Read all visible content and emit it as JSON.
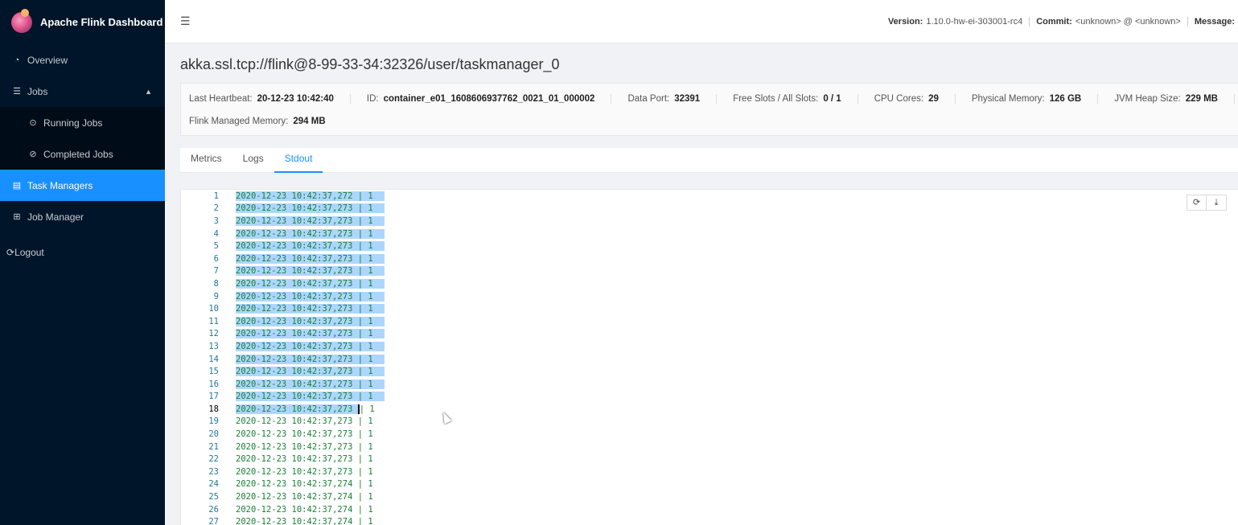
{
  "brand": {
    "title": "Apache Flink Dashboard"
  },
  "sidebar": {
    "items": [
      {
        "label": "Overview",
        "icon": "dashboard-icon"
      },
      {
        "label": "Jobs",
        "icon": "list-icon"
      },
      {
        "label": "Running Jobs",
        "icon": "play-circle-icon"
      },
      {
        "label": "Completed Jobs",
        "icon": "check-circle-icon"
      },
      {
        "label": "Task Managers",
        "icon": "schedule-icon"
      },
      {
        "label": "Job Manager",
        "icon": "build-icon"
      }
    ],
    "logout": "Logout"
  },
  "header": {
    "version_label": "Version:",
    "version": "1.10.0-hw-ei-303001-rc4",
    "commit_label": "Commit:",
    "commit": "<unknown> @ <unknown>",
    "message_label": "Message:"
  },
  "page": {
    "title": "akka.ssl.tcp://flink@8-99-33-34:32326/user/taskmanager_0"
  },
  "stats": {
    "row1": [
      {
        "label": "Last Heartbeat:",
        "value": "20-12-23 10:42:40"
      },
      {
        "label": "ID:",
        "value": "container_e01_1608606937762_0021_01_000002"
      },
      {
        "label": "Data Port:",
        "value": "32391"
      },
      {
        "label": "Free Slots / All Slots:",
        "value": "0 / 1"
      },
      {
        "label": "CPU Cores:",
        "value": "29"
      },
      {
        "label": "Physical Memory:",
        "value": "126 GB"
      },
      {
        "label": "JVM Heap Size:",
        "value": "229 MB"
      }
    ],
    "row2": [
      {
        "label": "Flink Managed Memory:",
        "value": "294 MB"
      }
    ]
  },
  "tabs": [
    "Metrics",
    "Logs",
    "Stdout"
  ],
  "active_tab": "Stdout",
  "stdout": {
    "lines": [
      "2020-12-23 10:42:37,272 | 1",
      "2020-12-23 10:42:37,273 | 1",
      "2020-12-23 10:42:37,273 | 1",
      "2020-12-23 10:42:37,273 | 1",
      "2020-12-23 10:42:37,273 | 1",
      "2020-12-23 10:42:37,273 | 1",
      "2020-12-23 10:42:37,273 | 1",
      "2020-12-23 10:42:37,273 | 1",
      "2020-12-23 10:42:37,273 | 1",
      "2020-12-23 10:42:37,273 | 1",
      "2020-12-23 10:42:37,273 | 1",
      "2020-12-23 10:42:37,273 | 1",
      "2020-12-23 10:42:37,273 | 1",
      "2020-12-23 10:42:37,273 | 1",
      "2020-12-23 10:42:37,273 | 1",
      "2020-12-23 10:42:37,273 | 1",
      "2020-12-23 10:42:37,273 | 1",
      "2020-12-23 10:42:37,273 | 1",
      "2020-12-23 10:42:37,273 | 1",
      "2020-12-23 10:42:37,273 | 1",
      "2020-12-23 10:42:37,273 | 1",
      "2020-12-23 10:42:37,273 | 1",
      "2020-12-23 10:42:37,273 | 1",
      "2020-12-23 10:42:37,274 | 1",
      "2020-12-23 10:42:37,274 | 1",
      "2020-12-23 10:42:37,274 | 1",
      "2020-12-23 10:42:37,274 | 1"
    ]
  },
  "toolbar": {
    "refresh_icon": "reload-icon",
    "download_icon": "download-icon"
  },
  "colors": {
    "sidebar_bg": "#001529",
    "accent": "#1890ff",
    "selection": "#add6ff",
    "log_text": "#1a7f37",
    "line_number": "#237893"
  }
}
